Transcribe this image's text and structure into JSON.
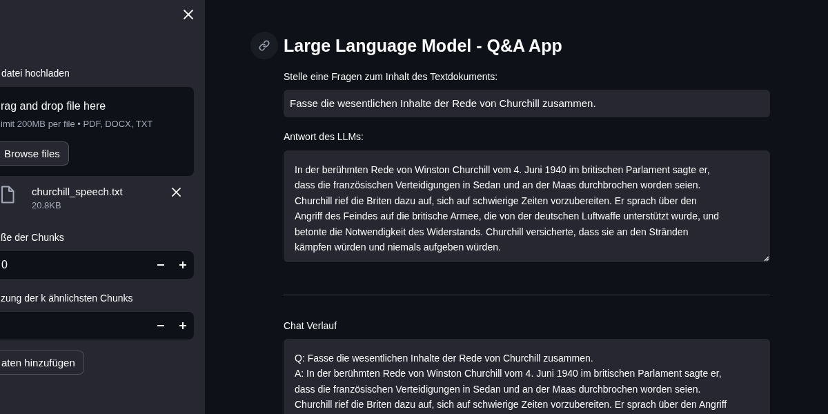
{
  "sidebar": {
    "uploader": {
      "label": "datei hochladen",
      "drop_title": "rag and drop file here",
      "limit": "imit 200MB per file • PDF, DOCX, TXT",
      "button": "Browse files"
    },
    "files": [
      {
        "name": "churchill_speech.txt",
        "size": "20.8KB"
      }
    ],
    "number_inputs": [
      {
        "label": "ße der Chunks",
        "value": "0"
      },
      {
        "label": "zung der k ähnlichsten Chunks"
      }
    ],
    "button": "aten hinzufügen"
  },
  "main": {
    "title": "Large Language Model - Q&A App",
    "question": {
      "label": "Stelle eine Fragen zum Inhalt des Textdokuments:",
      "value": "Fasse die wesentlichen Inhalte der Rede von Churchill zusammen."
    },
    "answer": {
      "label": "Antwort des LLMs:",
      "value": "In der berühmten Rede von Winston Churchill vom 4. Juni 1940 im britischen Parlament sagte er,\ndass die französischen Verteidigungen in Sedan und an der Maas durchbrochen worden seien.\nChurchill rief die Briten dazu auf, sich auf schwierige Zeiten vorzubereiten. Er sprach über den\nAngriff des Feindes auf die britische Armee, die von der deutschen Luftwaffe unterstützt wurde, und\nbetonte die Notwendigkeit des Widerstands. Churchill versicherte, dass sie an den Stränden\nkämpfen würden und niemals aufgeben würden."
    },
    "chat": {
      "label": "Chat Verlauf",
      "value": "Q: Fasse die wesentlichen Inhalte der Rede von Churchill zusammen.\nA: In der berühmten Rede von Winston Churchill vom 4. Juni 1940 im britischen Parlament sagte er,\ndass die französischen Verteidigungen in Sedan und an der Maas durchbrochen worden seien.\nChurchill rief die Briten dazu auf, sich auf schwierige Zeiten vorzubereiten. Er sprach über den Angriff"
    }
  }
}
